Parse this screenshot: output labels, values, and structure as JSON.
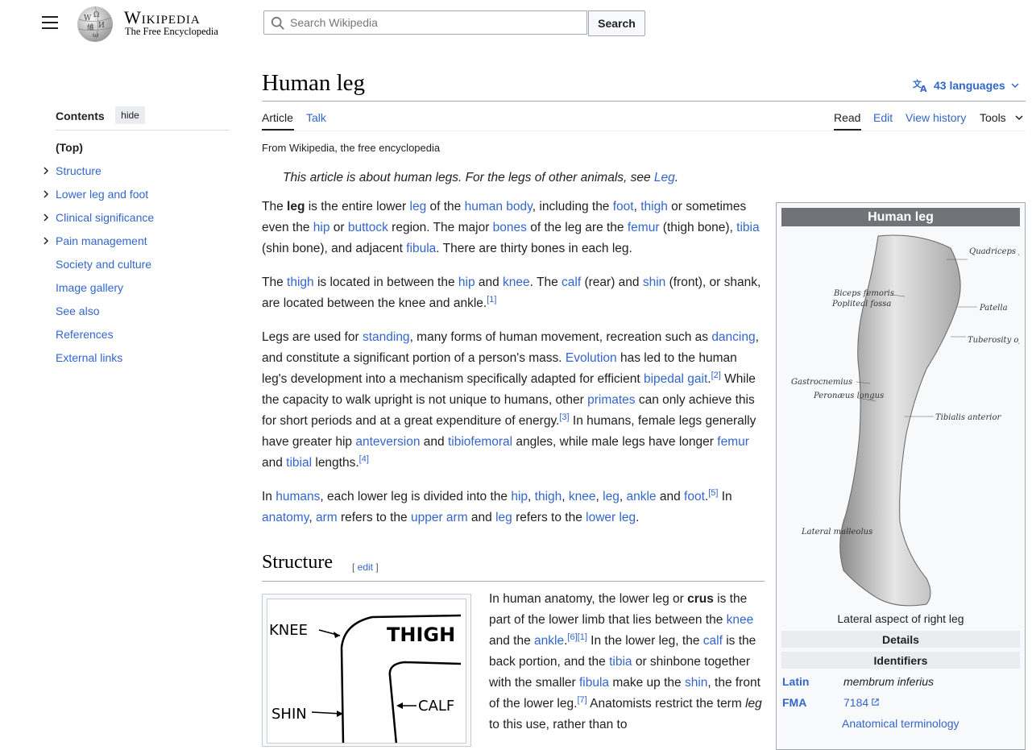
{
  "header": {
    "wordmark": "Wikipedia",
    "tagline": "The Free Encyclopedia",
    "search_placeholder": "Search Wikipedia",
    "search_button": "Search"
  },
  "toc": {
    "title": "Contents",
    "hide": "hide",
    "items": [
      {
        "label": "(Top)",
        "expandable": false
      },
      {
        "label": "Structure",
        "expandable": true
      },
      {
        "label": "Lower leg and foot",
        "expandable": true
      },
      {
        "label": "Clinical significance",
        "expandable": true
      },
      {
        "label": "Pain management",
        "expandable": true
      },
      {
        "label": "Society and culture",
        "expandable": false
      },
      {
        "label": "Image gallery",
        "expandable": false
      },
      {
        "label": "See also",
        "expandable": false
      },
      {
        "label": "References",
        "expandable": false
      },
      {
        "label": "External links",
        "expandable": false
      }
    ]
  },
  "article": {
    "title": "Human leg",
    "languages": "43 languages",
    "tabs": {
      "article": "Article",
      "talk": "Talk",
      "read": "Read",
      "edit": "Edit",
      "history": "View history",
      "tools": "Tools"
    },
    "from": "From Wikipedia, the free encyclopedia",
    "hatnote_text": "This article is about human legs. For the legs of other animals, see ",
    "hatnote_link": "Leg",
    "structure_heading": "Structure",
    "structure_edit": "edit"
  },
  "thumb": {
    "knee": "KNEE",
    "thigh": "THIGH",
    "shin": "SHIN",
    "calf": "CALF"
  },
  "infobox": {
    "title": "Human leg",
    "caption": "Lateral aspect of right leg",
    "details": "Details",
    "identifiers": "Identifiers",
    "latin_label": "Latin",
    "latin_value": "membrum inferius",
    "fma_label": "FMA",
    "fma_value": "7184",
    "anatomical": "Anatomical terminology",
    "figure_labels": {
      "quadriceps": "Quadriceps femoris",
      "biceps": "Biceps femoris",
      "popliteal": "Popliteal fossa",
      "patella": "Patella",
      "tuberosity": "Tuberosity of tibia",
      "gastrocnemius": "Gastrocnemius",
      "peronaeus": "Peronæus longus",
      "tibialis": "Tibialis anterior",
      "malleolus": "Lateral malleolus"
    }
  },
  "colors": {
    "link": "#3366cc",
    "infobox_title_bg": "#707478",
    "infobox_bg": "#f8f9fa"
  }
}
